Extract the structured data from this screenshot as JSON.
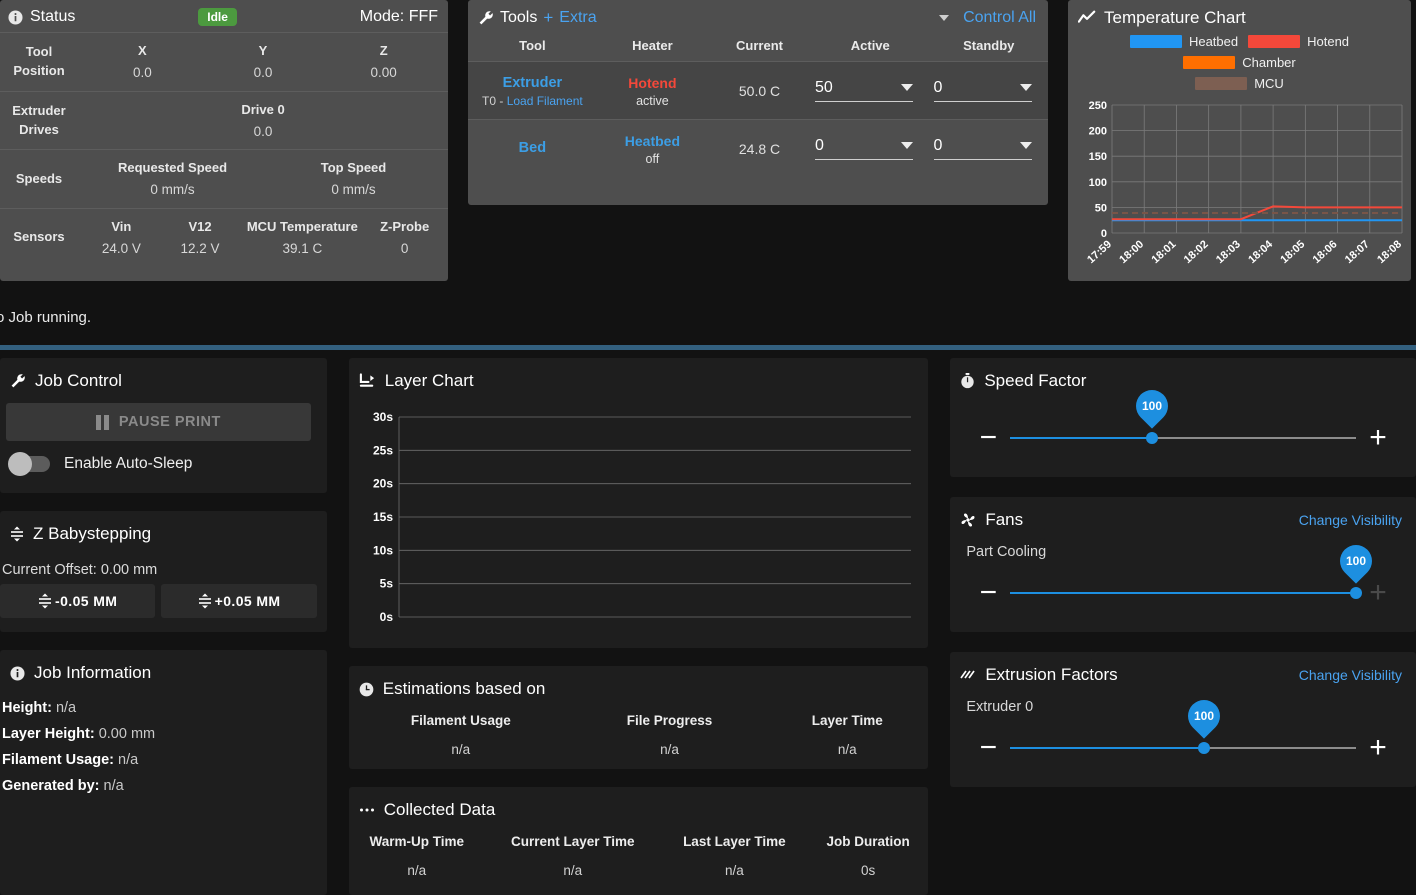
{
  "status": {
    "title": "Status",
    "icon": "info-icon",
    "badge": "Idle",
    "badge_color": "#4c9a3f",
    "mode": "Mode: FFF",
    "rows": [
      {
        "label": "Tool\nPosition",
        "label_line1": "Tool",
        "label_line2": "Position",
        "cells": [
          {
            "header": "X",
            "value": "0.0"
          },
          {
            "header": "Y",
            "value": "0.0"
          },
          {
            "header": "Z",
            "value": "0.00"
          }
        ]
      },
      {
        "label_line1": "Extruder",
        "label_line2": "Drives",
        "cells": [
          {
            "header": "Drive 0",
            "value": "0.0"
          }
        ]
      },
      {
        "label_line1": "Speeds",
        "label_line2": "",
        "cells": [
          {
            "header": "Requested Speed",
            "value": "0 mm/s"
          },
          {
            "header": "Top Speed",
            "value": "0 mm/s"
          }
        ]
      },
      {
        "label_line1": "Sensors",
        "label_line2": "",
        "cells": [
          {
            "header": "Vin",
            "value": "24.0 V"
          },
          {
            "header": "V12",
            "value": "12.2 V"
          },
          {
            "header": "MCU Temperature",
            "value": "39.1 C"
          },
          {
            "header": "Z-Probe",
            "value": "0"
          }
        ]
      }
    ]
  },
  "tools": {
    "title": "Tools",
    "icon": "wrench-icon",
    "extra_label": "Extra",
    "control_all_label": "Control All",
    "columns": [
      "Tool",
      "Heater",
      "Current",
      "Active",
      "Standby"
    ],
    "rows": [
      {
        "selected": true,
        "tool_name": "Extruder",
        "tool_sub_prefix": "T0 - ",
        "tool_sub_link": "Load Filament",
        "heater_name": "Hotend",
        "heater_color": "#f4483a",
        "heater_state": "active",
        "current": "50.0 C",
        "active": "50",
        "standby": "0"
      },
      {
        "selected": false,
        "tool_name": "Bed",
        "tool_sub_prefix": "",
        "tool_sub_link": "",
        "heater_name": "Heatbed",
        "heater_color": "#3c9ee5",
        "heater_state": "off",
        "current": "24.8 C",
        "active": "0",
        "standby": "0"
      }
    ]
  },
  "temp_chart_panel": {
    "title": "Temperature Chart",
    "icon": "chart-line-icon"
  },
  "job_status": {
    "message": "o Job running."
  },
  "job_control": {
    "title": "Job Control",
    "icon": "wrench-icon",
    "pause_label": "PAUSE PRINT",
    "auto_sleep_label": "Enable Auto-Sleep"
  },
  "z_babystepping": {
    "title": "Z Babystepping",
    "icon": "babystep-icon",
    "current_offset": "Current Offset: 0.00 mm",
    "minus_label": "-0.05 MM",
    "plus_label": "+0.05 MM"
  },
  "job_information": {
    "title": "Job Information",
    "icon": "info-icon",
    "items": [
      {
        "key": "Height:",
        "value": "n/a"
      },
      {
        "key": "Layer Height:",
        "value": "0.00 mm"
      },
      {
        "key": "Filament Usage:",
        "value": "n/a"
      },
      {
        "key": "Generated by:",
        "value": "n/a"
      }
    ]
  },
  "layer_chart_panel": {
    "title": "Layer Chart",
    "icon": "layer-chart-icon"
  },
  "estimations": {
    "title": "Estimations based on",
    "icon": "clock-icon",
    "columns": [
      "Filament Usage",
      "File Progress",
      "Layer Time"
    ],
    "values": [
      "n/a",
      "n/a",
      "n/a"
    ]
  },
  "collected_data": {
    "title": "Collected Data",
    "icon": "dots-icon",
    "columns": [
      "Warm-Up Time",
      "Current Layer Time",
      "Last Layer Time",
      "Job Duration"
    ],
    "values": [
      "n/a",
      "n/a",
      "n/a",
      "0s"
    ]
  },
  "speed_factor": {
    "title": "Speed Factor",
    "icon": "stopwatch-icon",
    "minus": "−",
    "plus": "+",
    "value": "100",
    "thumb_pct": 41
  },
  "fans": {
    "title": "Fans",
    "icon": "fan-icon",
    "change_visibility": "Change Visibility",
    "sub_label": "Part Cooling",
    "minus": "−",
    "plus": "+",
    "value": "100",
    "thumb_pct": 100,
    "plus_disabled": true
  },
  "extrusion_factors": {
    "title": "Extrusion Factors",
    "icon": "hatch-icon",
    "change_visibility": "Change Visibility",
    "sub_label": "Extruder 0",
    "minus": "−",
    "plus": "+",
    "value": "100",
    "thumb_pct": 56
  },
  "chart_data": [
    {
      "type": "line",
      "title": "Temperature Chart",
      "xlabel": "",
      "ylabel": "",
      "ylim": [
        0,
        250
      ],
      "yticks": [
        0,
        50,
        100,
        150,
        200,
        250
      ],
      "x": [
        "17:59",
        "18:00",
        "18:01",
        "18:02",
        "18:03",
        "18:04",
        "18:05",
        "18:06",
        "18:07",
        "18:08"
      ],
      "grid": true,
      "legend_position": "top",
      "series": [
        {
          "name": "Heatbed",
          "color": "#2196f3",
          "values": [
            24.8,
            24.8,
            24.8,
            24.8,
            24.8,
            24.8,
            24.8,
            24.8,
            24.8,
            24.8
          ]
        },
        {
          "name": "Hotend",
          "color": "#f4483a",
          "values": [
            27,
            27,
            27,
            27,
            27,
            52,
            50,
            50,
            50,
            50
          ]
        },
        {
          "name": "Chamber",
          "color": "#ff6f00",
          "values": []
        },
        {
          "name": "MCU",
          "color": "#795548",
          "dashed": true,
          "values": [
            39.1,
            39.1,
            39.1,
            39.1,
            39.1,
            39.1,
            39.1,
            39.1,
            39.1,
            39.1
          ]
        }
      ]
    },
    {
      "type": "line",
      "title": "Layer Chart",
      "xlabel": "",
      "ylabel": "",
      "ylim": [
        0,
        30
      ],
      "yticks": [
        "0s",
        "5s",
        "10s",
        "15s",
        "20s",
        "25s",
        "30s"
      ],
      "x": [],
      "grid": true,
      "series": []
    }
  ]
}
